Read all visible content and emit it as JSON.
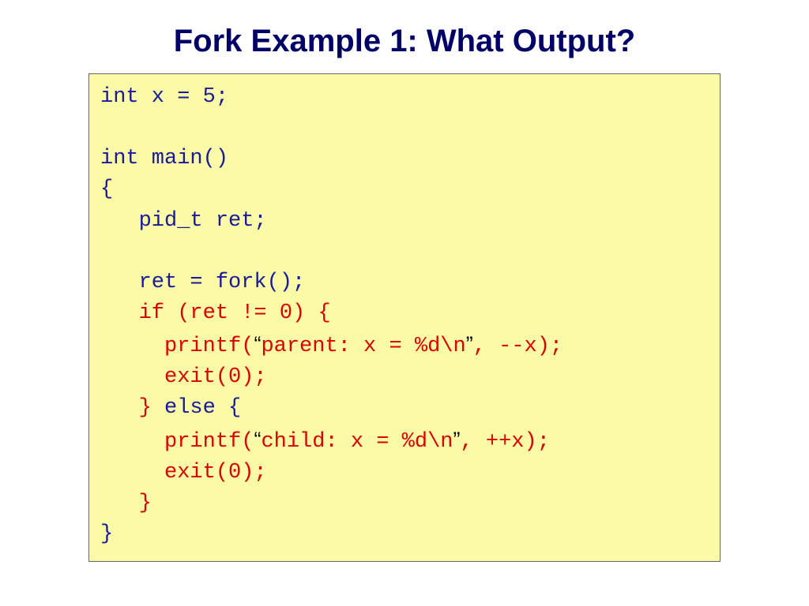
{
  "title": "Fork Example 1: What Output?",
  "code": {
    "l1": "int x = 5;",
    "l2": "",
    "l3": "int main()",
    "l4": "{",
    "l5": "   pid_t ret;",
    "l6": "",
    "l7": "   ret = fork();",
    "l8a": "   ",
    "l8b": "if (ret != 0) {",
    "l9a": "     printf(",
    "l9q1": "“",
    "l9b": "parent: x = %d\\n",
    "l9q2": "”",
    "l9c": ", --x);",
    "l10": "     exit(0);",
    "l11a": "   ",
    "l11b": "}",
    "l11c": " else {",
    "l12a": "     printf(",
    "l12q1": "“",
    "l12b": "child: x = %d\\n",
    "l12q2": "”",
    "l12c": ", ++x);",
    "l13": "     exit(0);",
    "l14": "   ",
    "l14b": "}",
    "l15": "}"
  }
}
